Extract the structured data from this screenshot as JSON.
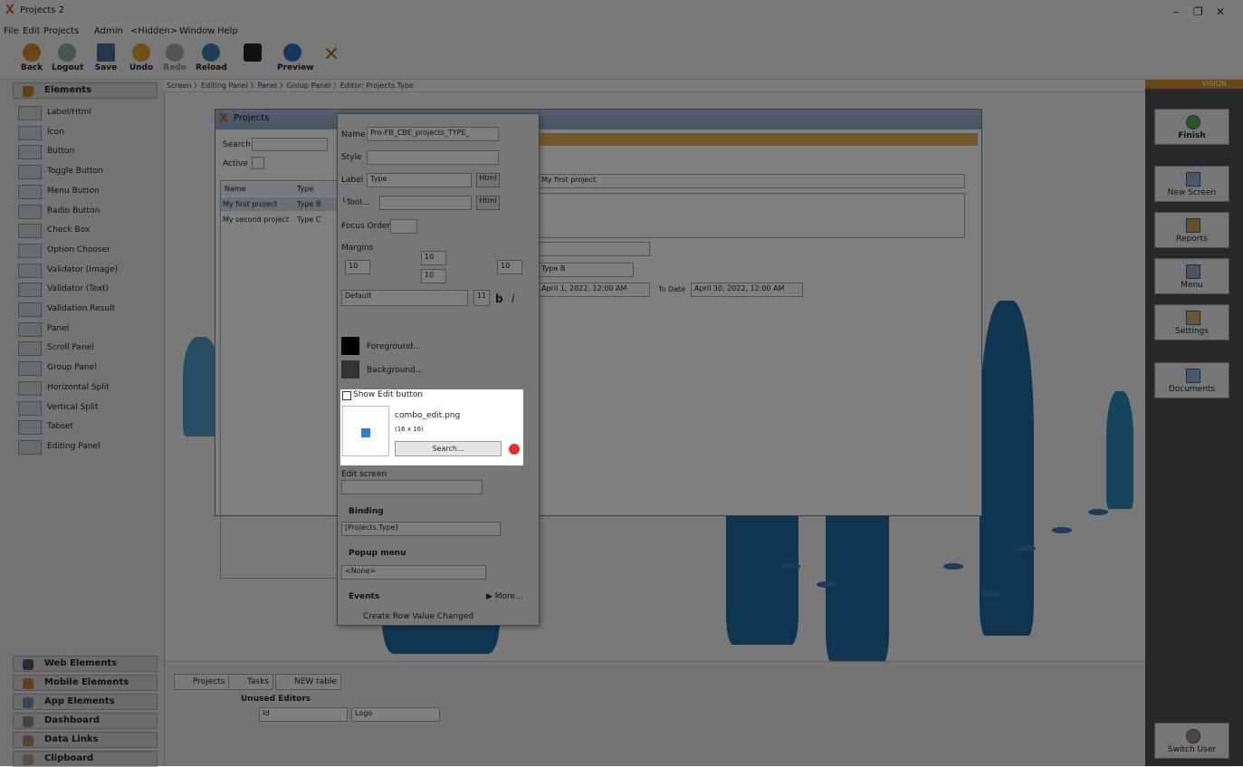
{
  "app": {
    "title": "Projects 2",
    "menu": [
      "File",
      "Edit",
      "Projects",
      "Admin",
      "<Hidden>",
      "Window",
      "Help"
    ],
    "toolbar": [
      "Back",
      "Logout",
      "Save",
      "Undo",
      "Redo",
      "Reload",
      "",
      "Preview"
    ],
    "window_controls": [
      "–",
      "❐",
      "✕"
    ]
  },
  "breadcrumb": "Screen 〉Editing Panel 〉Panel 〉Group Panel 〉Editor: Projects.Type",
  "left": {
    "header": "Elements",
    "items": [
      "Label/Html",
      "Icon",
      "Button",
      "Toggle Button",
      "Menu Button",
      "Radio Button",
      "Check Box",
      "Option Chooser",
      "Validator (Image)",
      "Validator (Text)",
      "Validation Result",
      "Panel",
      "Scroll Panel",
      "Group Panel",
      "Horizontal Split",
      "Vertical Split",
      "Tabset",
      "Editing Panel"
    ],
    "sections": [
      "Web Elements",
      "Mobile Elements",
      "App Elements",
      "Dashboard",
      "Data Links",
      "Clipboard"
    ]
  },
  "right": {
    "vision": "VISION",
    "buttons": [
      "Finish",
      "New Screen",
      "Reports",
      "Menu",
      "Settings",
      "Documents"
    ],
    "switch_user": "Switch User"
  },
  "projects": {
    "title": "Projects",
    "search_label": "Search",
    "active_label": "Active",
    "columns": [
      "Name",
      "Type"
    ],
    "rows": [
      [
        "My first project",
        "Type B"
      ],
      [
        "My second project",
        "Type C"
      ]
    ],
    "name_value": "My first project",
    "type_value": "Type B",
    "from_date": "April 1, 2022, 12:00 AM",
    "to_label": "To Date",
    "to_date": "April 30, 2022, 12:00 AM"
  },
  "editor": {
    "name_label": "Name",
    "name_value": "Pro-FB_CBE_projects_TYPE_",
    "style_label": "Style",
    "label_label": "Label",
    "label_value": "Type",
    "html": "Html",
    "tool_label": "└Tool...",
    "focus_label": "Focus Order",
    "margins_label": "Margins",
    "m_top": "10",
    "m_left": "10",
    "m_right": "10",
    "m_bottom": "10",
    "font": "Default",
    "font_size": "11",
    "bold": "b",
    "italic": "i",
    "foreground": "Foreground...",
    "background": "Background...",
    "show_edit": "Show Edit button",
    "img_name": "combo_edit.png",
    "img_size": "(16 x 16)",
    "search_btn": "Search...",
    "edit_screen": "Edit screen",
    "binding_label": "Binding",
    "binding_value": "[Projects.Type]",
    "popup_label": "Popup menu",
    "popup_value": "<None>",
    "events_label": "Events",
    "more": "▶ More...",
    "event_item": "Create Row Value Changed"
  },
  "bottom": {
    "tabs": [
      "Projects",
      "Tasks",
      "NEW table"
    ],
    "unused": "Unused Editors",
    "id": "Id",
    "logo": "Logo"
  }
}
